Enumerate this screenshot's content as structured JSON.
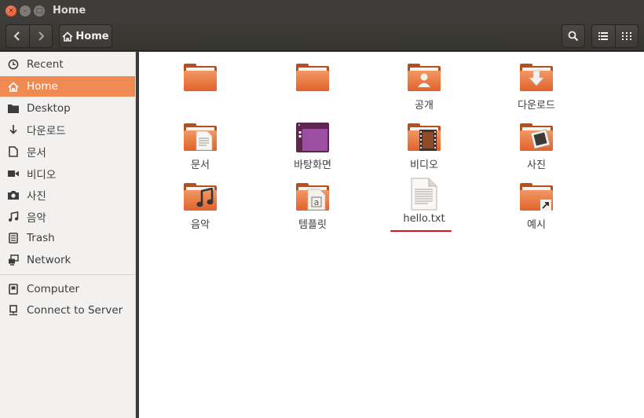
{
  "window": {
    "title": "Home",
    "close_glyph": "×",
    "min_glyph": "–",
    "max_glyph": "□"
  },
  "toolbar": {
    "path_label": "Home",
    "back_icon": "chevron-left-icon",
    "forward_icon": "chevron-right-icon",
    "search_icon": "search-icon",
    "list_view_icon": "list-view-icon",
    "grid_view_icon": "grid-view-icon"
  },
  "sidebar": {
    "items": [
      {
        "label": "Recent",
        "icon": "clock-icon"
      },
      {
        "label": "Home",
        "icon": "home-icon",
        "active": true
      },
      {
        "label": "Desktop",
        "icon": "folder-icon"
      },
      {
        "label": "다운로드",
        "icon": "download-icon"
      },
      {
        "label": "문서",
        "icon": "document-icon"
      },
      {
        "label": "비디오",
        "icon": "video-icon"
      },
      {
        "label": "사진",
        "icon": "camera-icon"
      },
      {
        "label": "음악",
        "icon": "music-icon"
      },
      {
        "label": "Trash",
        "icon": "trash-icon"
      },
      {
        "label": "Network",
        "icon": "network-icon"
      }
    ],
    "devices": [
      {
        "label": "Computer",
        "icon": "computer-icon"
      },
      {
        "label": "Connect to Server",
        "icon": "server-icon"
      }
    ]
  },
  "files": [
    {
      "label": "",
      "type": "folder"
    },
    {
      "label": "",
      "type": "folder"
    },
    {
      "label": "공개",
      "type": "folder-public"
    },
    {
      "label": "다운로드",
      "type": "folder-download"
    },
    {
      "label": "문서",
      "type": "folder-documents"
    },
    {
      "label": "바탕화면",
      "type": "folder-desktop"
    },
    {
      "label": "비디오",
      "type": "folder-videos"
    },
    {
      "label": "사진",
      "type": "folder-pictures"
    },
    {
      "label": "음악",
      "type": "folder-music"
    },
    {
      "label": "템플릿",
      "type": "folder-templates"
    },
    {
      "label": "hello.txt",
      "type": "text-file"
    },
    {
      "label": "예시",
      "type": "folder-link"
    }
  ],
  "colors": {
    "accent": "#f08a53",
    "highlight_underline": "#e0101b"
  }
}
